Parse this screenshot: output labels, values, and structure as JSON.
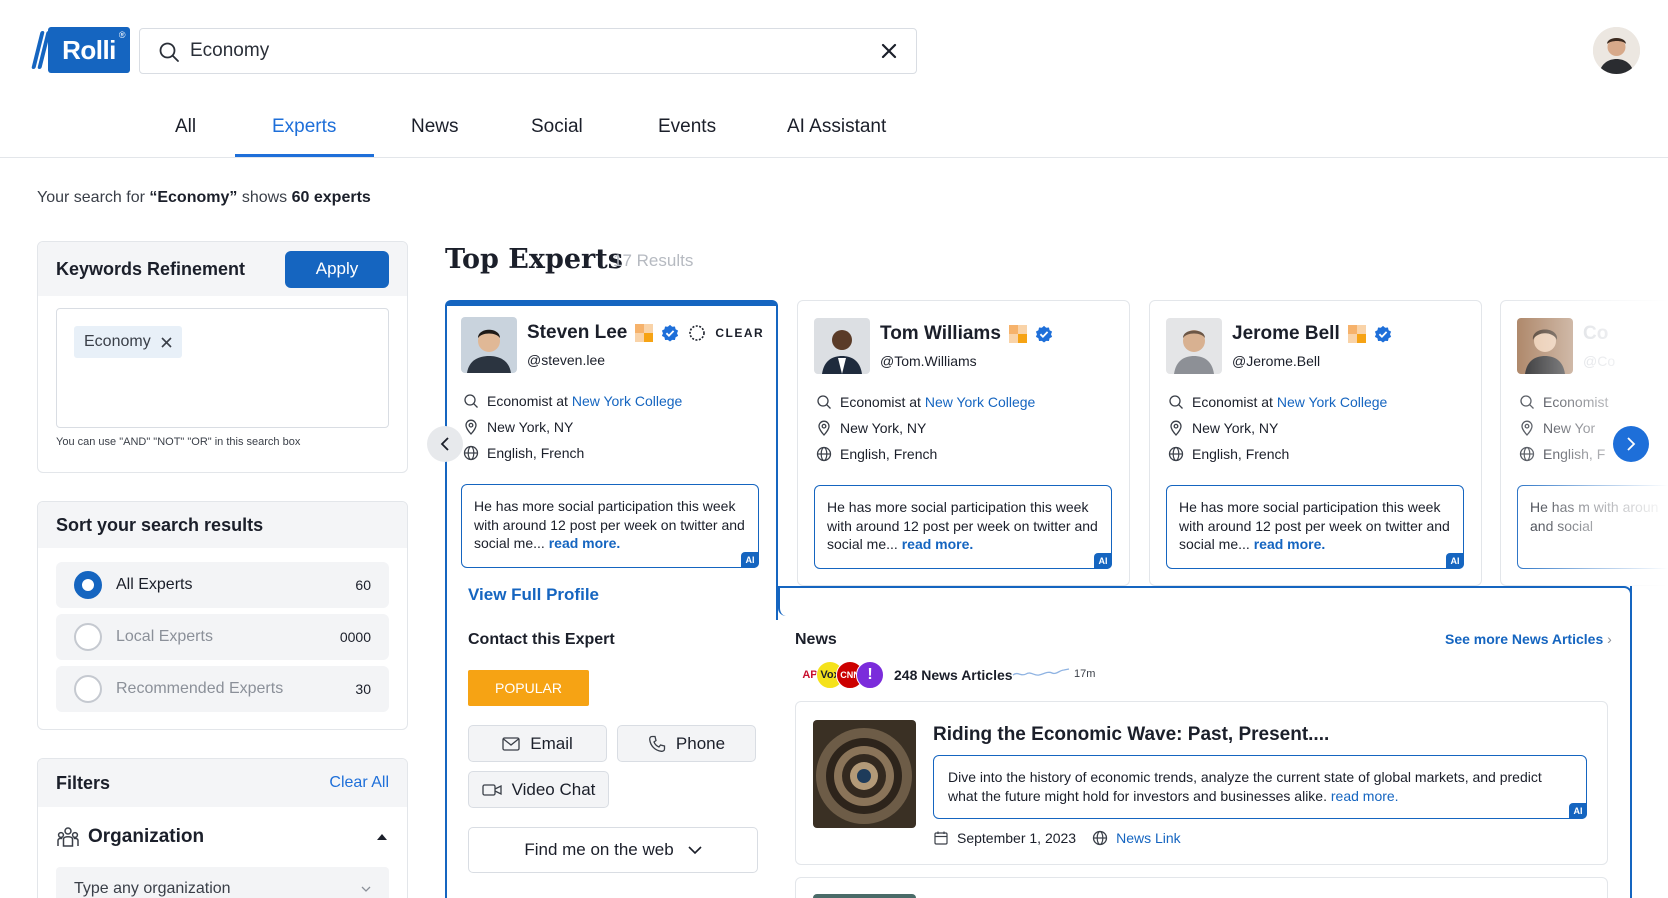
{
  "brand": {
    "name": "Rolli"
  },
  "search": {
    "value": "Economy"
  },
  "tabs": [
    {
      "label": "All"
    },
    {
      "label": "Experts",
      "active": true
    },
    {
      "label": "News"
    },
    {
      "label": "Social"
    },
    {
      "label": "Events"
    },
    {
      "label": "AI Assistant"
    }
  ],
  "summary": {
    "prefix": "Your search for ",
    "query": "“Economy”",
    "mid": " shows ",
    "count": "60 experts"
  },
  "keywords": {
    "title": "Keywords Refinement",
    "apply_label": "Apply",
    "chip": "Economy",
    "hint": "You can use \"AND\" \"NOT\" \"OR\" in this search box"
  },
  "sort": {
    "title": "Sort your search results",
    "items": [
      {
        "label": "All Experts",
        "count": "60",
        "selected": true
      },
      {
        "label": "Local Experts",
        "count": "0000",
        "selected": false
      },
      {
        "label": "Recommended Experts",
        "count": "30",
        "selected": false
      }
    ]
  },
  "filters": {
    "title": "Filters",
    "clear_label": "Clear All",
    "org_title": "Organization",
    "org_placeholder": "Type any organization"
  },
  "top_experts": {
    "title": "Top Experts",
    "results": "17 Results"
  },
  "experts": [
    {
      "name": "Steven Lee",
      "handle": "@steven.lee",
      "role_prefix": "Economist at",
      "org": "New York College",
      "location": "New York, NY",
      "languages": "English, French",
      "summary": "He has more social participation this week with around 12 post per week on twitter and social me...",
      "read_more": "read more.",
      "badge": "CLEAR"
    },
    {
      "name": "Tom Williams",
      "handle": "@Tom.Williams",
      "role_prefix": "Economist at",
      "org": "New York College",
      "location": "New York, NY",
      "languages": "English, French",
      "summary": "He has more social participation this week with around 12 post per week on twitter and social me...",
      "read_more": "read more."
    },
    {
      "name": "Jerome Bell",
      "handle": "@Jerome.Bell",
      "role_prefix": "Economist at",
      "org": "New York College",
      "location": "New York, NY",
      "languages": "English, French",
      "summary": "He has more social participation this week with around 12 post per week on twitter and social me...",
      "read_more": "read more."
    },
    {
      "name": "Co",
      "handle": "@Co",
      "role_prefix": "Economist",
      "location": "New Yor",
      "languages": "English, F",
      "summary": "He has m with aroun and social"
    }
  ],
  "ai_badge": "AI",
  "detail": {
    "view_profile": "View Full Profile",
    "contact_title": "Contact this Expert",
    "popular": "POPULAR",
    "email": "Email",
    "phone": "Phone",
    "video": "Video Chat",
    "find_me": "Find me on the web"
  },
  "news": {
    "title": "News",
    "see_more": "See more News Articles",
    "sources": [
      "AP",
      "Vox",
      "CNN",
      "!"
    ],
    "count": "248 News Articles",
    "time": "17m",
    "article": {
      "headline": "Riding the Economic Wave: Past, Present....",
      "summary": "Dive into the history of economic trends, analyze the current state of global markets, and predict what the future might hold for investors and businesses alike.",
      "read_more": "read more.",
      "date": "September 1, 2023",
      "link": "News Link"
    }
  },
  "colors": {
    "accent": "#1565c0",
    "link": "#1e6fd9",
    "popular": "#f6a314"
  }
}
